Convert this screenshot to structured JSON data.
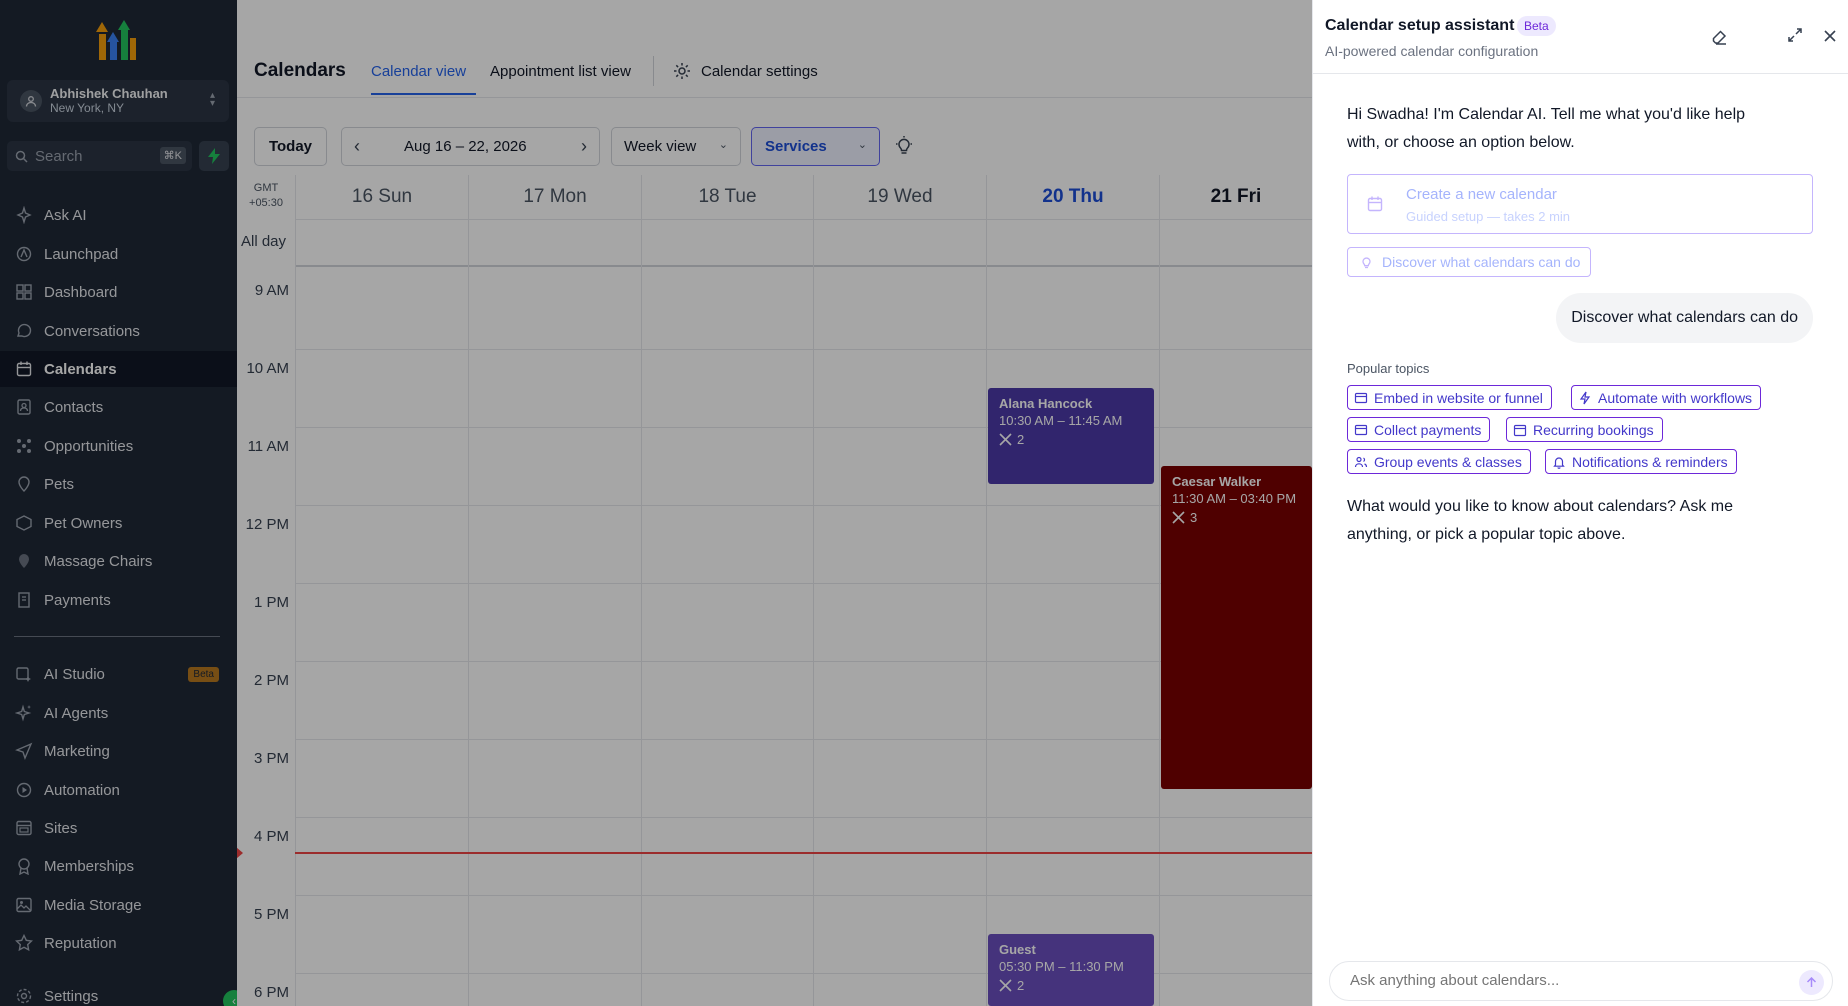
{
  "sidebar": {
    "account": {
      "name": "Abhishek Chauhan",
      "location": "New York, NY"
    },
    "search": {
      "placeholder": "Search",
      "shortcut": "⌘K"
    },
    "items": [
      {
        "label": "Ask AI",
        "icon": "sparkle-icon"
      },
      {
        "label": "Launchpad",
        "icon": "rocket-icon"
      },
      {
        "label": "Dashboard",
        "icon": "grid-icon"
      },
      {
        "label": "Conversations",
        "icon": "chat-icon"
      },
      {
        "label": "Calendars",
        "icon": "calendar-icon",
        "active": true
      },
      {
        "label": "Contacts",
        "icon": "contacts-icon"
      },
      {
        "label": "Opportunities",
        "icon": "opportunities-icon"
      },
      {
        "label": "Pets",
        "icon": "pin-icon"
      },
      {
        "label": "Pet Owners",
        "icon": "box-icon"
      },
      {
        "label": "Massage Chairs",
        "icon": "pin-icon"
      },
      {
        "label": "Payments",
        "icon": "receipt-icon"
      }
    ],
    "items2": [
      {
        "label": "AI Studio",
        "icon": "ai-studio-icon",
        "badge": "Beta"
      },
      {
        "label": "AI Agents",
        "icon": "sparkle-icon"
      },
      {
        "label": "Marketing",
        "icon": "send-icon"
      },
      {
        "label": "Automation",
        "icon": "automation-icon"
      },
      {
        "label": "Sites",
        "icon": "sites-icon"
      },
      {
        "label": "Memberships",
        "icon": "award-icon"
      },
      {
        "label": "Media Storage",
        "icon": "image-icon"
      },
      {
        "label": "Reputation",
        "icon": "star-icon"
      }
    ],
    "settings": "Settings"
  },
  "main": {
    "title": "Calendars",
    "tabs": [
      "Calendar view",
      "Appointment list view"
    ],
    "settings_label": "Calendar settings",
    "toolbar": {
      "today": "Today",
      "range": "Aug 16 – 22, 2026",
      "view": "Week view",
      "filter": "Services"
    },
    "gmt": [
      "GMT",
      "+05:30"
    ],
    "allday": "All day",
    "days": [
      "16 Sun",
      "17 Mon",
      "18 Tue",
      "19 Wed",
      "20 Thu",
      "21 Fri"
    ],
    "today_index": 4,
    "times": [
      "9 AM",
      "10 AM",
      "11 AM",
      "12 PM",
      "1 PM",
      "2 PM",
      "3 PM",
      "4 PM",
      "5 PM",
      "6 PM"
    ],
    "events": [
      {
        "name": "Alana Hancock",
        "time": "10:30 AM – 11:45 AM",
        "count": "2",
        "color": "#4c3aa8"
      },
      {
        "name": "Caesar Walker",
        "time": "11:30 AM – 03:40 PM",
        "count": "3",
        "color": "#7a0000"
      },
      {
        "name": "Guest",
        "time": "05:30 PM – 11:30 PM",
        "count": "2",
        "color": "#6a4fbf"
      }
    ]
  },
  "panel": {
    "title": "Calendar setup assistant",
    "beta": "Beta",
    "subtitle": "AI-powered calendar configuration",
    "greeting_1": "Hi Swadha! I'm Calendar AI. Tell me what you'd like help",
    "greeting_2": "with, or choose an option below.",
    "create_title": "Create a new calendar",
    "create_sub": "Guided setup — takes 2 min",
    "discover": "Discover what calendars can do",
    "user_msg": "Discover what calendars can do",
    "popular_label": "Popular topics",
    "topics": [
      "Embed in website or funnel",
      "Automate with workflows",
      "Collect payments",
      "Recurring bookings",
      "Group events & classes",
      "Notifications & reminders"
    ],
    "reply_1": "What would you like to know about calendars? Ask me",
    "reply_2": "anything, or pick a popular topic above.",
    "input_placeholder": "Ask anything about calendars...",
    "accent": "#6d28d9"
  }
}
